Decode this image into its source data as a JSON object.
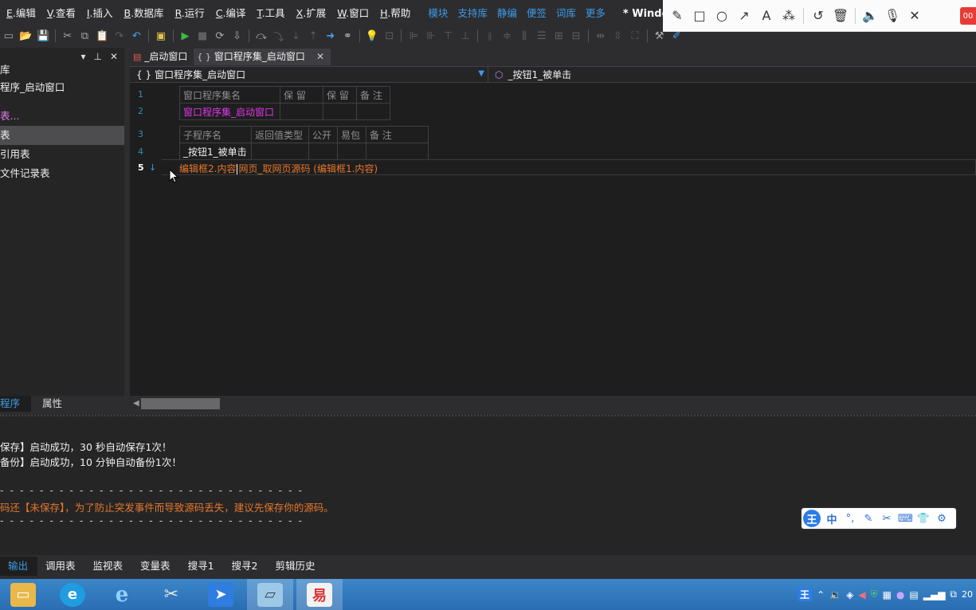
{
  "menu": {
    "items": [
      {
        "key": "E",
        "label": ".编辑"
      },
      {
        "key": "V",
        "label": ".查看"
      },
      {
        "key": "I",
        "label": ".插入"
      },
      {
        "key": "B",
        "label": ".数据库"
      },
      {
        "key": "R",
        "label": ".运行"
      },
      {
        "key": "C",
        "label": ".编译"
      },
      {
        "key": "T",
        "label": ".工具"
      },
      {
        "key": "X",
        "label": ".扩展"
      },
      {
        "key": "W",
        "label": ".窗口"
      },
      {
        "key": "H",
        "label": ".帮助"
      }
    ],
    "links": [
      "模块",
      "支持库",
      "静编",
      "便签",
      "词库",
      "更多"
    ],
    "window_title": "* Windows窗口程序"
  },
  "screenshot_tool": {
    "tools": [
      "pencil-icon",
      "rectangle-icon",
      "circle-icon",
      "arrow-icon",
      "text-icon",
      "magic-wand-icon",
      "undo-icon",
      "delete-icon",
      "speaker-icon",
      "microphone-icon",
      "close-icon"
    ],
    "record_label": "00"
  },
  "left_panel": {
    "items": [
      {
        "label": "程序_启动窗口",
        "style": "normal"
      },
      {
        "label": "表...",
        "style": "highlight"
      },
      {
        "label": "表",
        "style": "selected"
      },
      {
        "label": "引用表",
        "style": "normal"
      },
      {
        "label": "文件记录表",
        "style": "normal"
      }
    ],
    "top_partial": "库",
    "tabs": [
      "程序",
      "属性"
    ]
  },
  "editor_tabs": [
    {
      "label": "_启动窗口",
      "active": false
    },
    {
      "label": "窗口程序集_启动窗口",
      "active": true
    }
  ],
  "nav": {
    "class_selector": "窗口程序集_启动窗口",
    "method_selector": "_按钮1_被单击"
  },
  "code": {
    "line_numbers": [
      "1",
      "2",
      "3",
      "4",
      "5"
    ],
    "assembly_table": {
      "headers": [
        "窗口程序集名",
        "保 留",
        "保 留",
        "备 注"
      ],
      "row": [
        "窗口程序集_启动窗口",
        "",
        "",
        ""
      ]
    },
    "sub_table": {
      "headers": [
        "子程序名",
        "返回值类型",
        "公开",
        "易包",
        "备 注"
      ],
      "row": [
        "_按钮1_被单击",
        "",
        "",
        "",
        ""
      ]
    },
    "line5_before_caret": "编辑框2.内容",
    "line5_after_caret": "网页_取网页源码 (编辑框1.内容)"
  },
  "output": {
    "lines": [
      {
        "text": "保存】启动成功，30 秒自动保存1次！",
        "style": "white"
      },
      {
        "text": "备份】启动成功，10 分钟自动备份1次！",
        "style": "white"
      },
      {
        "text": "- - - - - - - - - - - - - - - - - - - - - - - - - - - - - - -",
        "style": "dash"
      },
      {
        "text": "码还【未保存】，为了防止突发事件而导致源码丢失，建议先保存你的源码。",
        "style": "orange"
      },
      {
        "text": "- - - - - - - - - - - - - - - - - - - - - - - - - - - - - - -",
        "style": "dash"
      }
    ]
  },
  "ime": {
    "logo": "王",
    "mode": "中",
    "icons": [
      "punctuation-icon",
      "pen-icon",
      "scissors-icon",
      "keyboard-icon",
      "skin-icon",
      "settings-icon"
    ]
  },
  "bottom_tabs": [
    "输出",
    "调用表",
    "监视表",
    "变量表",
    "搜寻1",
    "搜寻2",
    "剪辑历史"
  ],
  "taskbar": {
    "apps": [
      "file-explorer-icon",
      "edge-icon",
      "ie-icon",
      "tool-app-icon",
      "feishu-icon",
      "notepad-icon",
      "e-language-icon"
    ],
    "tray_clock": "20"
  }
}
